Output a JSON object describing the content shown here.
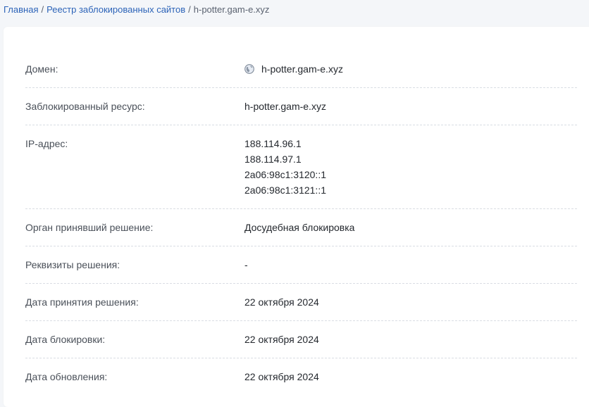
{
  "breadcrumb": {
    "home": "Главная",
    "registry": "Реестр заблокированных сайтов",
    "current": "h-potter.gam-e.xyz",
    "separator": "/"
  },
  "details": {
    "domain": {
      "label": "Домен:",
      "value": "h-potter.gam-e.xyz",
      "icon": "globe-icon"
    },
    "resource": {
      "label": "Заблокированный ресурс:",
      "value": "h-potter.gam-e.xyz"
    },
    "ip": {
      "label": "IP-адрес:",
      "values": [
        "188.114.96.1",
        "188.114.97.1",
        "2a06:98c1:3120::1",
        "2a06:98c1:3121::1"
      ]
    },
    "authority": {
      "label": "Орган принявший решение:",
      "value": "Досудебная блокировка"
    },
    "requisites": {
      "label": "Реквизиты решения:",
      "value": "-"
    },
    "decision_date": {
      "label": "Дата принятия решения:",
      "value": "22 октября 2024"
    },
    "block_date": {
      "label": "Дата блокировки:",
      "value": "22 октября 2024"
    },
    "update_date": {
      "label": "Дата обновления:",
      "value": "22 октября 2024"
    }
  },
  "colors": {
    "link": "#2c63b8",
    "text": "#24282e",
    "label": "#4a5059",
    "divider": "#d9dde3",
    "background": "#f4f6f9"
  }
}
